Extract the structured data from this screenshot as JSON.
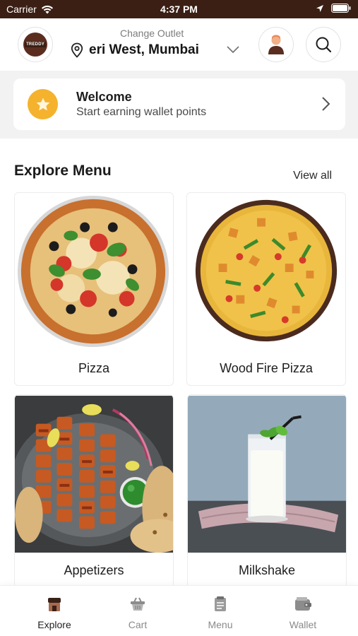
{
  "status_bar": {
    "carrier": "Carrier",
    "time": "4:37 PM"
  },
  "header": {
    "logo_text": "TREDDY",
    "change_outlet_label": "Change Outlet",
    "outlet_name": "eri West, Mumbai"
  },
  "welcome": {
    "title": "Welcome",
    "subtitle": "Start earning wallet points"
  },
  "explore": {
    "title": "Explore Menu",
    "view_all": "View all",
    "items": [
      {
        "label": "Pizza"
      },
      {
        "label": "Wood Fire Pizza"
      },
      {
        "label": "Appetizers"
      },
      {
        "label": "Milkshake"
      }
    ]
  },
  "tabs": [
    {
      "label": "Explore",
      "icon": "store-icon",
      "active": true
    },
    {
      "label": "Cart",
      "icon": "basket-icon",
      "active": false
    },
    {
      "label": "Menu",
      "icon": "menu-book-icon",
      "active": false
    },
    {
      "label": "Wallet",
      "icon": "wallet-icon",
      "active": false
    }
  ],
  "colors": {
    "status_bar": "#3b1f14",
    "accent_star": "#f5b22d",
    "band": "#f2f2f2"
  }
}
